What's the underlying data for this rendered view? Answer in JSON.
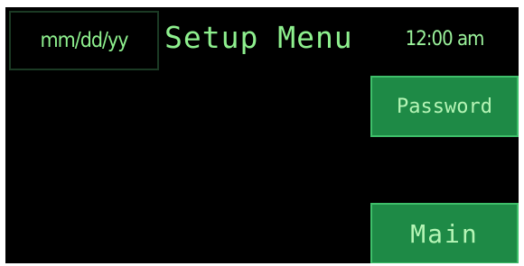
{
  "header": {
    "date_label": "mm/dd/yy",
    "title": "Setup Menu",
    "time_label": "12:00 am"
  },
  "buttons": {
    "password_label": "Password",
    "main_label": "Main"
  },
  "colors": {
    "screen_background": "#000000",
    "text_green": "#8ef08e",
    "button_fill": "#1e8a46",
    "button_border": "#3fbf6a",
    "date_box_border": "#1b3a24"
  }
}
